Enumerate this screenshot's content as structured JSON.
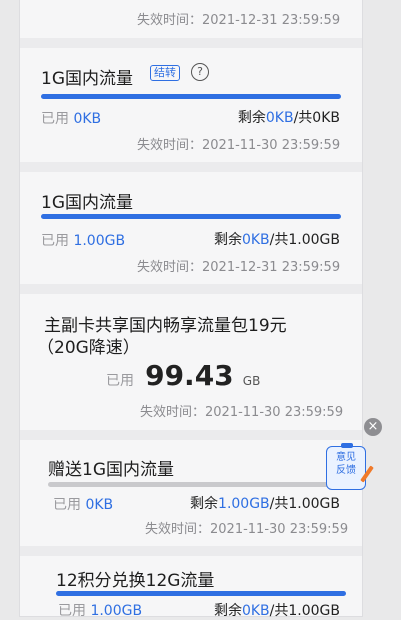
{
  "items": [
    {
      "expiry_label": "失效时间：",
      "expiry": "2021-12-31 23:59:59"
    },
    {
      "title": "1G国内流量",
      "tag": "结转",
      "used_label": "已用",
      "used": "0KB",
      "remain_label": "剩余",
      "remain": "0KB",
      "total": "/共0KB",
      "expiry_label": "失效时间：",
      "expiry": "2021-11-30 23:59:59",
      "progress": 1.0
    },
    {
      "title": "1G国内流量",
      "used_label": "已用",
      "used": "1.00GB",
      "remain_label": "剩余",
      "remain": "0KB",
      "total": "/共1.00GB",
      "expiry_label": "失效时间：",
      "expiry": "2021-12-31 23:59:59",
      "progress": 1.0
    },
    {
      "title_line1": "主副卡共享国内畅享流量包19元",
      "title_line2": "（20G降速）",
      "used_label": "已用",
      "used_value": "99.43",
      "used_unit": "GB",
      "expiry_label": "失效时间：",
      "expiry": "2021-11-30 23:59:59"
    },
    {
      "title": "赠送1G国内流量",
      "used_label": "已用",
      "used": "0KB",
      "remain_label": "剩余",
      "remain": "1.00GB",
      "total": "/共1.00GB",
      "expiry_label": "失效时间：",
      "expiry": "2021-11-30 23:59:59",
      "progress": 0.0
    },
    {
      "title": "12积分兑换12G流量",
      "used_label": "已用",
      "used": "1.00GB",
      "remain_label": "剩余",
      "remain": "0KB",
      "total": "/共1.00GB",
      "progress": 1.0
    }
  ],
  "feedback": {
    "line1": "意见",
    "line2": "反馈"
  },
  "close_symbol": "×",
  "help_symbol": "?",
  "colors": {
    "accent": "#2f6fe2",
    "muted": "#8b8b8f",
    "background": "#f6f6f7"
  }
}
